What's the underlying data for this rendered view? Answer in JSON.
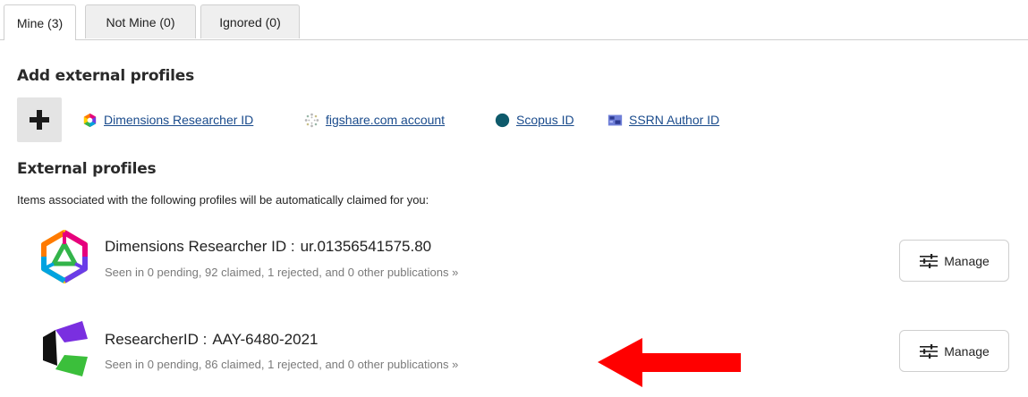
{
  "tabs": [
    {
      "label": "Mine (3)",
      "active": true
    },
    {
      "label": "Not Mine (0)",
      "active": false
    },
    {
      "label": "Ignored (0)",
      "active": false
    }
  ],
  "add_section": {
    "title": "Add external profiles",
    "links": [
      {
        "label": "Dimensions Researcher ID",
        "icon": "dimensions-icon"
      },
      {
        "label": "figshare.com account",
        "icon": "figshare-icon"
      },
      {
        "label": "Scopus ID",
        "icon": "scopus-icon"
      },
      {
        "label": "SSRN Author ID",
        "icon": "ssrn-icon"
      }
    ]
  },
  "external_section": {
    "title": "External profiles",
    "description": "Items associated with the following profiles will be automatically claimed for you:",
    "profiles": [
      {
        "name": "Dimensions Researcher ID :",
        "id": "ur.01356541575.80",
        "stats": "Seen in 0 pending, 92 claimed, 1 rejected, and 0 other publications »",
        "button": "Manage",
        "icon": "dimensions-logo-icon"
      },
      {
        "name": "ResearcherID :",
        "id": "AAY-6480-2021",
        "stats": "Seen in 0 pending, 86 claimed, 1 rejected, and 0 other publications »",
        "button": "Manage",
        "icon": "researcherid-logo-icon"
      }
    ]
  },
  "colors": {
    "link": "#1a4b8c",
    "arrow": "#ff0000",
    "tab_inactive": "#efefef",
    "scopus_dot": "#0e5a6b"
  }
}
